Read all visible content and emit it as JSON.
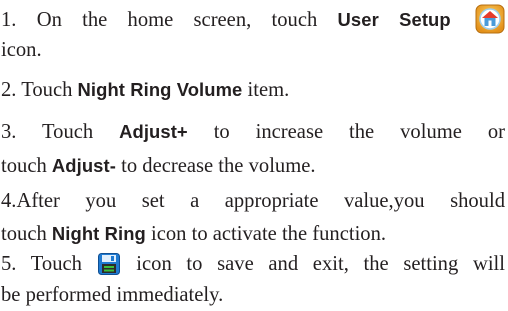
{
  "steps": [
    {
      "pre": "1. On the home screen, touch ",
      "keyword": "User Setup",
      "icon": "user-setup-home-icon",
      "post": "icon."
    },
    {
      "pre": "2. Touch ",
      "keyword": "Night Ring Volume",
      "post": " item."
    },
    {
      "pre": "3. Touch ",
      "keyword": "Adjust+",
      "mid": " to increase the volume or touch ",
      "keyword2": "Adjust-",
      "post": " to decrease the volume."
    },
    {
      "pre": "4.After you set a appropriate value,you should touch ",
      "keyword": "Night Ring",
      "post": " icon to activate the function."
    },
    {
      "pre": "5. Touch ",
      "icon": "save-exit-icon",
      "post": " icon to save and exit, the setting will be performed immediately."
    }
  ],
  "colors": {
    "text": "#231f20",
    "home_icon_bg": "#f2b12e",
    "home_icon_roof": "#e53b2c",
    "save_icon_bg": "#1f7ad1",
    "save_icon_accent": "#3bbf3b"
  }
}
